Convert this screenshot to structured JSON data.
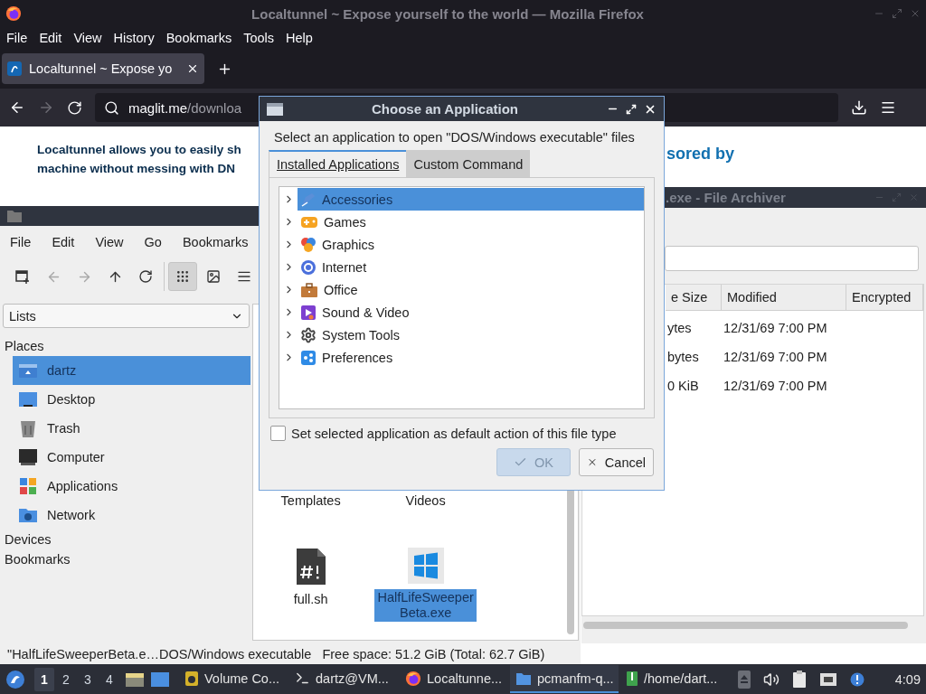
{
  "firefox": {
    "title": "Localtunnel ~ Expose yourself to the world — Mozilla Firefox",
    "menu": [
      "File",
      "Edit",
      "View",
      "History",
      "Bookmarks",
      "Tools",
      "Help"
    ],
    "tabs": [
      {
        "label": "Localtunnel ~ Expose yo",
        "selected": true
      }
    ],
    "url": {
      "host": "maglit.me",
      "path": "/downloa"
    },
    "page": {
      "lines": [
        "Localtunnel allows you to easily sh",
        "machine without messing with DN"
      ],
      "aside": "sored by"
    }
  },
  "file_manager": {
    "menu": [
      "File",
      "Edit",
      "View",
      "Go",
      "Bookmarks"
    ],
    "toolbar": [
      {
        "kind": "new-tab",
        "disabled": false,
        "selected": false
      },
      {
        "kind": "back",
        "disabled": true,
        "selected": false
      },
      {
        "kind": "forward",
        "disabled": true,
        "selected": false
      },
      {
        "kind": "up",
        "disabled": false,
        "selected": false
      },
      {
        "kind": "reload",
        "disabled": false,
        "selected": false
      },
      {
        "kind": "icon-view",
        "disabled": false,
        "selected": true
      },
      {
        "kind": "thumbnail-view",
        "disabled": false,
        "selected": false
      },
      {
        "kind": "list-view",
        "disabled": false,
        "selected": false
      }
    ],
    "sidebar": {
      "dropdown": "Lists",
      "sections": [
        {
          "title": "Places",
          "items": [
            {
              "label": "dartz",
              "kind": "home",
              "selected": true
            },
            {
              "label": "Desktop",
              "kind": "desktop",
              "selected": false
            },
            {
              "label": "Trash",
              "kind": "trash",
              "selected": false
            },
            {
              "label": "Computer",
              "kind": "computer",
              "selected": false
            },
            {
              "label": "Applications",
              "kind": "applications",
              "selected": false
            },
            {
              "label": "Network",
              "kind": "network",
              "selected": false
            }
          ]
        },
        {
          "title": "Devices"
        },
        {
          "title": "Bookmarks"
        }
      ]
    },
    "files": [
      {
        "lines": [
          "Templates"
        ],
        "kind": "covered",
        "selected": false
      },
      {
        "lines": [
          "Videos"
        ],
        "kind": "covered",
        "selected": false
      },
      {
        "lines": [
          "full.sh"
        ],
        "kind": "script",
        "selected": false
      },
      {
        "lines": [
          "HalfLifeSweeper",
          "Beta.exe"
        ],
        "kind": "executable",
        "selected": true
      }
    ],
    "status": {
      "selection": "\"HalfLifeSweeperBeta.e…DOS/Windows executable",
      "free_space": "Free space: 51.2 GiB (Total: 62.7 GiB)"
    }
  },
  "archiver": {
    "title": ".exe - File Archiver",
    "columns": [
      "e Size",
      "Modified",
      "Encrypted"
    ],
    "rows": [
      {
        "size": "ytes",
        "modified": "12/31/69 7:00 PM"
      },
      {
        "size": "bytes",
        "modified": "12/31/69 7:00 PM"
      },
      {
        "size": "0 KiB",
        "modified": "12/31/69 7:00 PM"
      }
    ]
  },
  "dialog": {
    "title": "Choose an Application",
    "prompt": "Select an application to open \"DOS/Windows executable\" files",
    "tabs": [
      {
        "label": "Installed Applications",
        "selected": true
      },
      {
        "label": "Custom Command",
        "selected": false
      }
    ],
    "categories": [
      {
        "label": "Accessories",
        "kind": "accessories",
        "selected": true,
        "expanded": false
      },
      {
        "label": "Games",
        "kind": "games",
        "selected": false,
        "expanded": false
      },
      {
        "label": "Graphics",
        "kind": "graphics",
        "selected": false,
        "expanded": false
      },
      {
        "label": "Internet",
        "kind": "internet",
        "selected": false,
        "expanded": false
      },
      {
        "label": "Office",
        "kind": "office",
        "selected": false,
        "expanded": false
      },
      {
        "label": "Sound & Video",
        "kind": "sound-video",
        "selected": false,
        "expanded": false
      },
      {
        "label": "System Tools",
        "kind": "system-tools",
        "selected": false,
        "expanded": false
      },
      {
        "label": "Preferences",
        "kind": "preferences",
        "selected": false,
        "expanded": false
      }
    ],
    "default_option": {
      "label": "Set selected application as default action of this file type",
      "checked": false
    },
    "buttons": [
      {
        "label": "OK",
        "kind": "ok",
        "disabled": true
      },
      {
        "label": "Cancel",
        "kind": "cancel",
        "disabled": false
      }
    ]
  },
  "taskbar": {
    "desktops": [
      {
        "label": "1",
        "selected": true
      },
      {
        "label": "2",
        "selected": false
      },
      {
        "label": "3",
        "selected": false
      },
      {
        "label": "4",
        "selected": false
      }
    ],
    "tasks": [
      {
        "label": "Volume Co...",
        "kind": "volume",
        "selected": false
      },
      {
        "label": "dartz@VM...",
        "kind": "terminal",
        "selected": false
      },
      {
        "label": "Localtunne...",
        "kind": "browser",
        "selected": false
      },
      {
        "label": "pcmanfm-q...",
        "kind": "files",
        "selected": true
      },
      {
        "label": "/home/dart...",
        "kind": "archive",
        "selected": false
      }
    ],
    "clock": "4:09"
  }
}
